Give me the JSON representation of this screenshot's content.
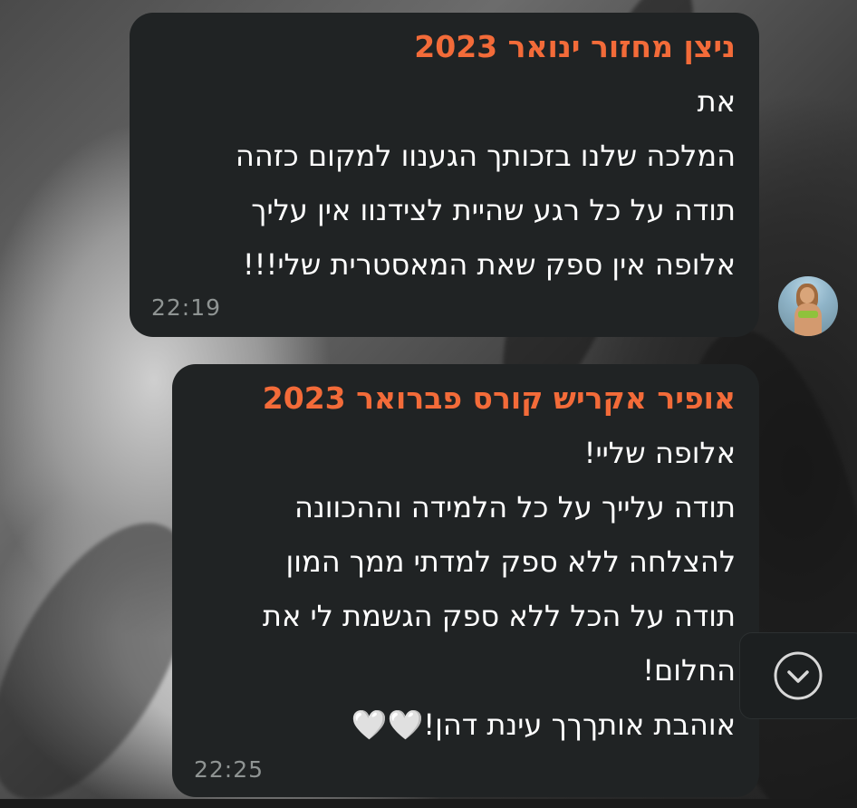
{
  "messages": [
    {
      "sender": "ניצן מחזור ינואר 2023",
      "lines": [
        "את",
        "המלכה שלנו בזכותך הגענוו למקום כזהה",
        "תודה על כל רגע שהיית לצידנוו אין עליך",
        "אלופה אין ספק שאת המאסטרית שלי!!!"
      ],
      "time": "22:19"
    },
    {
      "sender": "אופיר אקריש קורס פברואר 2023",
      "lines": [
        "אלופה שליי!",
        "תודה עלייך על כל הלמידה וההכוונה",
        "להצלחה ללא ספק למדתי ממך המון",
        "תודה על הכל ללא ספק הגשמת לי את",
        "החלום!",
        "אוהבת אותךךך עינת דהן!🤍🤍"
      ],
      "time": "22:25"
    }
  ],
  "scroll_button": {
    "icon": "chevron-down-circle-icon"
  },
  "colors": {
    "bubble_bg": "#202324",
    "sender_name": "#f36b39",
    "timestamp": "#8f9493",
    "message_text": "#ffffff"
  }
}
